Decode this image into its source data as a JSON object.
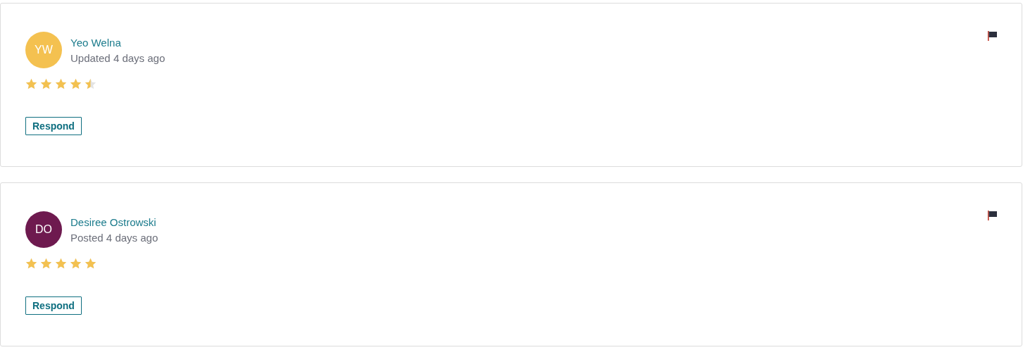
{
  "reviews": [
    {
      "initials": "YW",
      "color": "#f4c150",
      "name": "Yeo Welna",
      "status": "Updated 4 days ago",
      "stars": 4.5,
      "button": "Respond"
    },
    {
      "initials": "DO",
      "color": "#6e1a4f",
      "name": "Desiree Ostrowski",
      "status": "Posted 4 days ago",
      "stars": 5,
      "button": "Respond"
    }
  ]
}
